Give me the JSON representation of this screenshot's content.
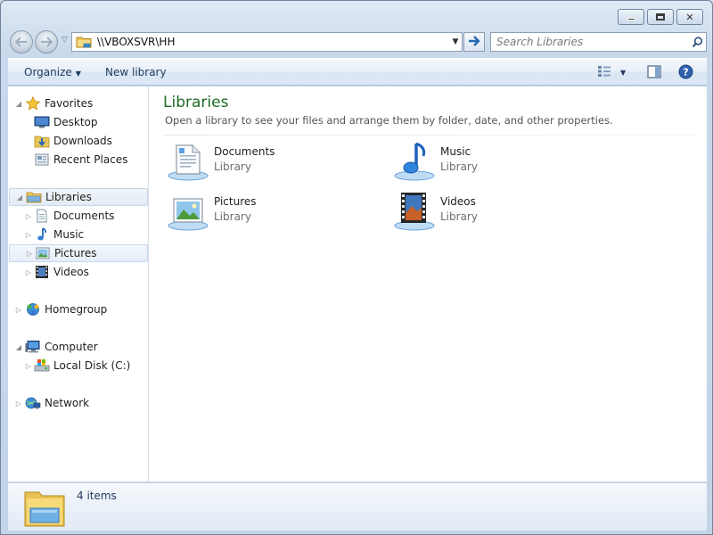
{
  "window": {
    "minimize_glyph": "",
    "maximize_glyph": "",
    "close_glyph": "✕"
  },
  "navigation": {
    "back_icon": "back-arrow-icon",
    "forward_icon": "forward-arrow-icon",
    "address_path": "\\\\VBOXSVR\\HH",
    "search_placeholder": "Search Libraries"
  },
  "command_bar": {
    "organize_label": "Organize",
    "new_library_label": "New library"
  },
  "sidebar": {
    "favorites": {
      "label": "Favorites",
      "items": [
        {
          "label": "Desktop",
          "icon": "desktop-icon"
        },
        {
          "label": "Downloads",
          "icon": "downloads-icon"
        },
        {
          "label": "Recent Places",
          "icon": "recent-places-icon"
        }
      ]
    },
    "libraries": {
      "label": "Libraries",
      "items": [
        {
          "label": "Documents",
          "icon": "documents-icon"
        },
        {
          "label": "Music",
          "icon": "music-icon"
        },
        {
          "label": "Pictures",
          "icon": "pictures-icon"
        },
        {
          "label": "Videos",
          "icon": "videos-icon"
        }
      ]
    },
    "homegroup": {
      "label": "Homegroup"
    },
    "computer": {
      "label": "Computer",
      "items": [
        {
          "label": "Local Disk (C:)",
          "icon": "local-disk-icon"
        }
      ]
    },
    "network": {
      "label": "Network"
    }
  },
  "content": {
    "title": "Libraries",
    "subtitle": "Open a library to see your files and arrange them by folder, date, and other properties.",
    "libraries": [
      {
        "name": "Documents",
        "type": "Library",
        "icon": "documents-library-icon"
      },
      {
        "name": "Music",
        "type": "Library",
        "icon": "music-library-icon"
      },
      {
        "name": "Pictures",
        "type": "Library",
        "icon": "pictures-library-icon"
      },
      {
        "name": "Videos",
        "type": "Library",
        "icon": "videos-library-icon"
      }
    ]
  },
  "details": {
    "item_count": "4 items"
  },
  "colors": {
    "title_green": "#1e6b24",
    "command_text": "#1e395b",
    "secondary_text": "#6d6d6d"
  }
}
